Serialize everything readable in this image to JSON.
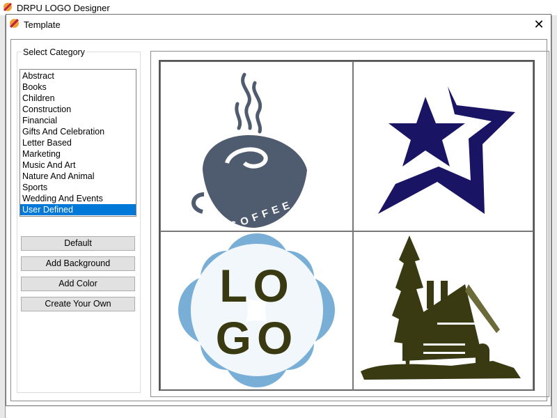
{
  "app": {
    "title": "DRPU LOGO Designer"
  },
  "dialog": {
    "title": "Template",
    "close": "✕"
  },
  "category": {
    "label": "Select Category",
    "items": [
      "Abstract",
      "Books",
      "Children",
      "Construction",
      "Financial",
      "Gifts And Celebration",
      "Letter Based",
      "Marketing",
      "Music And Art",
      "Nature And Animal",
      "Sports",
      "Wedding And Events",
      "User Defined"
    ],
    "selected": "User Defined"
  },
  "buttons": {
    "default": "Default",
    "add_background": "Add Background",
    "add_color": "Add Color",
    "create_own": "Create Your Own"
  },
  "templates": {
    "coffee": {
      "text": "COFFEE",
      "color": "#4f5b6e"
    },
    "star": {
      "color": "#1a1464"
    },
    "logo": {
      "line1": "LO",
      "line2": "GO",
      "text_color": "#3a3a12",
      "accent": "#79aed6"
    },
    "cabin": {
      "color": "#3a3a12"
    }
  },
  "colors": {
    "selection": "#0078d7"
  }
}
